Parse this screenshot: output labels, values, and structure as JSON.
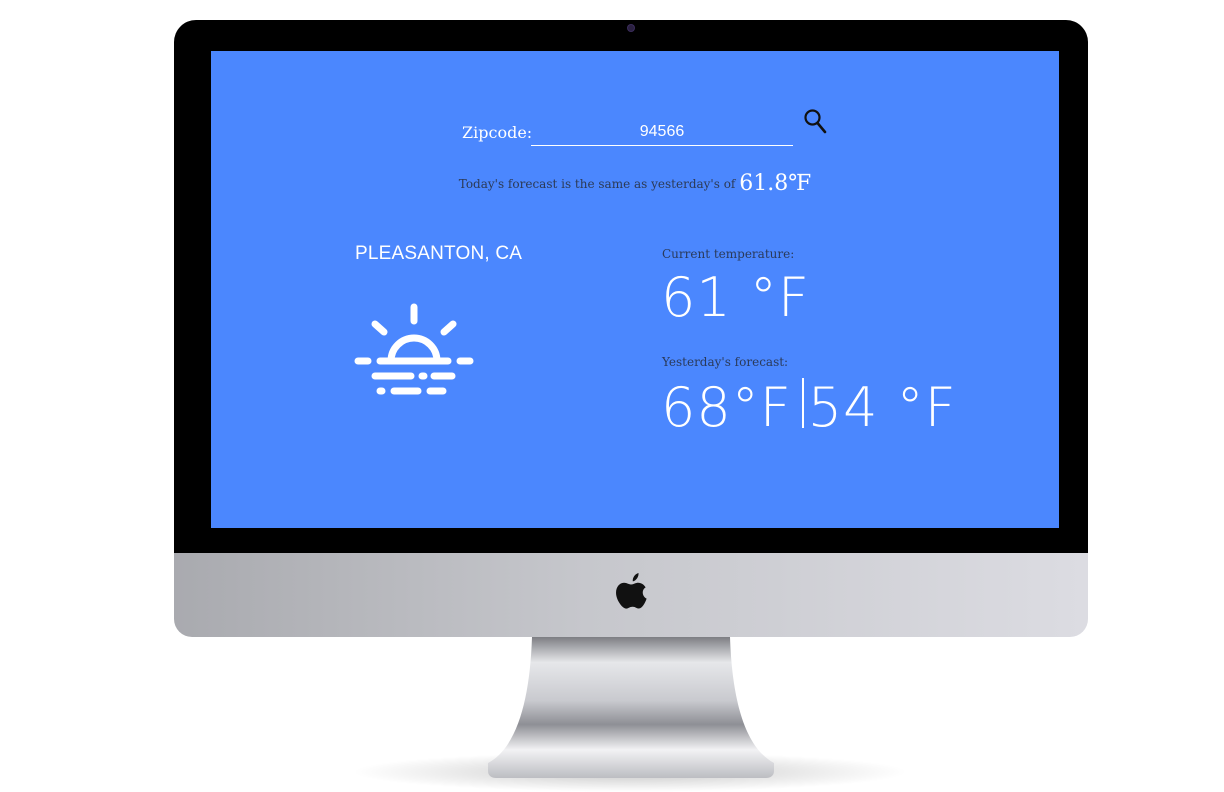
{
  "device": {
    "brand_logo_icon": "apple-logo-icon"
  },
  "search": {
    "zip_label": "Zipcode:",
    "zip_value": "94566",
    "search_icon": "search-icon"
  },
  "forecast": {
    "comparison_text": "Today's forecast is the same as yesterday's of",
    "comparison_temp": "61.8℉"
  },
  "location": {
    "city": "PLEASANTON, CA",
    "weather_icon": "sunrise-fog-icon"
  },
  "current": {
    "label": "Current temperature:",
    "temp": "61 °F"
  },
  "yesterday": {
    "label": "Yesterday's forecast:",
    "high": "68°F",
    "low": "54 °F"
  },
  "colors": {
    "screen_background": "#4b87fe",
    "text": "#ffffff",
    "secondary_text": "#2a3a5a",
    "bezel": "#000000"
  }
}
